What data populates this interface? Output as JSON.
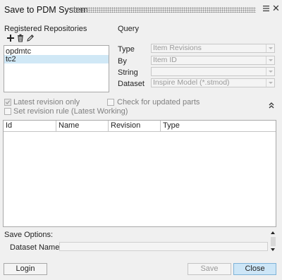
{
  "window": {
    "title": "Save to PDM System"
  },
  "repositories": {
    "heading": "Registered Repositories",
    "items": [
      {
        "label": "opdmtc",
        "selected": false
      },
      {
        "label": "tc2",
        "selected": true
      }
    ],
    "toolbar_icons": [
      "add-icon",
      "delete-icon",
      "edit-icon"
    ]
  },
  "query": {
    "heading": "Query",
    "fields": [
      {
        "label": "Type",
        "value": "Item Revisions"
      },
      {
        "label": "By",
        "value": "Item ID"
      },
      {
        "label": "String",
        "value": ""
      },
      {
        "label": "Dataset",
        "value": "Inspire Model (*.stmod)"
      }
    ]
  },
  "options": {
    "latest_revision_only": {
      "label": "Latest revision only",
      "checked": true
    },
    "set_revision_rule": {
      "label": "Set revision rule (Latest Working)",
      "checked": false
    },
    "check_updated_parts": {
      "label": "Check for updated parts",
      "checked": false
    }
  },
  "results_table": {
    "columns": [
      "Id",
      "Name",
      "Revision",
      "Type"
    ],
    "rows": []
  },
  "save_options": {
    "heading": "Save Options:",
    "dataset_name_label": "Dataset Name:",
    "dataset_name_value": ""
  },
  "buttons": {
    "login": "Login",
    "save": "Save",
    "close": "Close"
  },
  "colors": {
    "selection": "#d0e8f6",
    "primary_button": "#cde6f7",
    "background": "#f0f0f0"
  }
}
